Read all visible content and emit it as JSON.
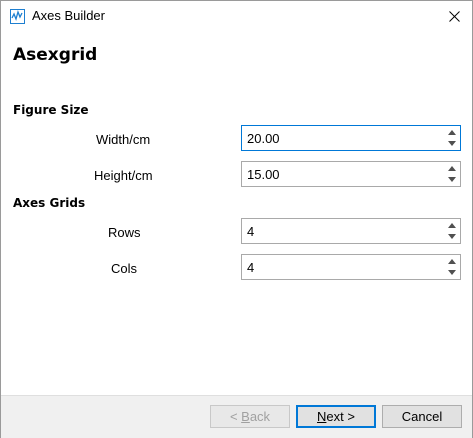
{
  "window": {
    "title": "Axes Builder"
  },
  "page": {
    "heading": "Asexgrid"
  },
  "figure_size": {
    "section_title": "Figure Size",
    "width_label": "Width/cm",
    "width_value": "20.00",
    "height_label": "Height/cm",
    "height_value": "15.00"
  },
  "axes_grids": {
    "section_title": "Axes Grids",
    "rows_label": "Rows",
    "rows_value": "4",
    "cols_label": "Cols",
    "cols_value": "4"
  },
  "buttons": {
    "back_prefix": "< ",
    "back_mnemonic": "B",
    "back_rest": "ack",
    "next_mnemonic": "N",
    "next_rest": "ext >",
    "cancel": "Cancel"
  },
  "colors": {
    "focus_accent": "#0078d7",
    "app_icon": "#1e7fd0"
  }
}
